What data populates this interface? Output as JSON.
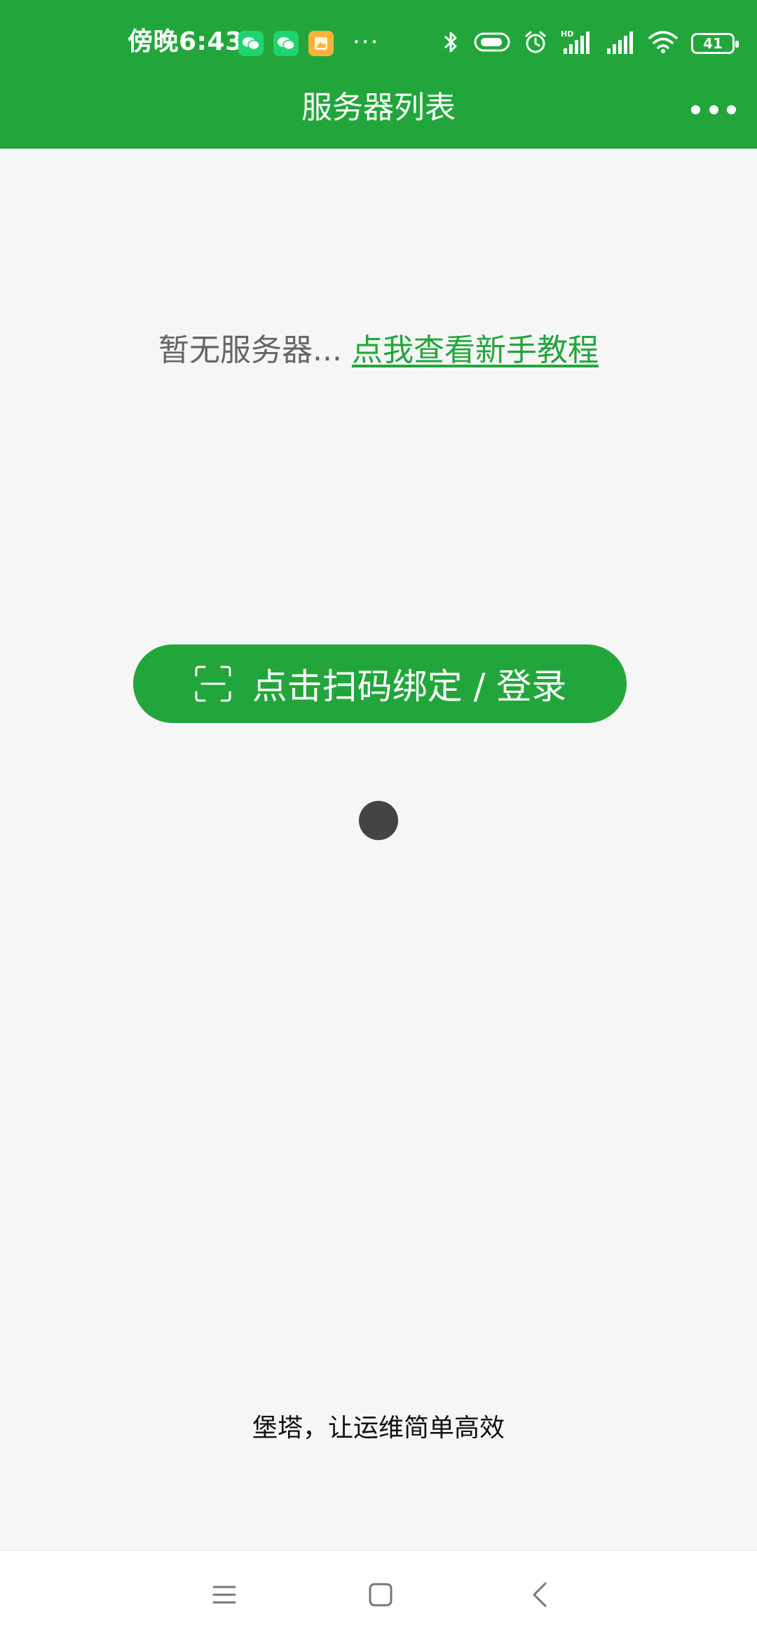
{
  "status_bar": {
    "time": "傍晚6:43",
    "overflow_dots": "···",
    "battery_level": "41",
    "notification_icons": [
      "wechat-icon",
      "wechat-icon",
      "gallery-icon"
    ],
    "system_icons": [
      "bluetooth-icon",
      "battery-saver-icon",
      "alarm-icon",
      "hd-signal-icon",
      "signal-icon",
      "wifi-icon",
      "battery-icon"
    ]
  },
  "header": {
    "title": "服务器列表",
    "more_icon": "more-horizontal-icon"
  },
  "empty_state": {
    "text": "暂无服务器... ",
    "link": "点我查看新手教程"
  },
  "scan_button": {
    "label": "点击扫码绑定 / 登录",
    "icon": "scan-icon"
  },
  "footer": {
    "slogan": "堡塔，让运维简单高效"
  },
  "nav_bar": {
    "items": [
      "menu-icon",
      "home-icon",
      "back-icon"
    ]
  },
  "colors": {
    "brand_green": "#22a63b",
    "background": "#f6f6f6",
    "text_gray": "#666666",
    "dot_gray": "#444444"
  }
}
